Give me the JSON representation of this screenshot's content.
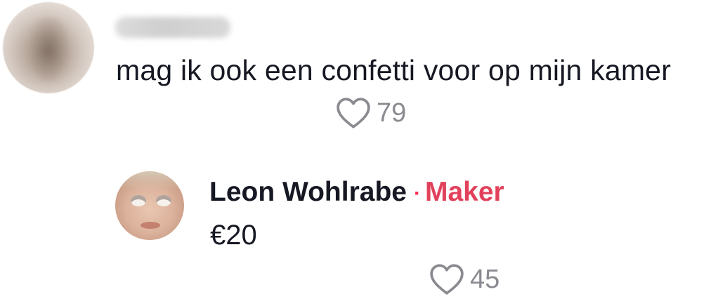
{
  "comment": {
    "username": "",
    "text": "mag ik ook een confetti voor op mijn kamer",
    "likes": "79"
  },
  "reply": {
    "author_name": "Leon Wohlrabe",
    "separator": "·",
    "author_role": "Maker",
    "text": "€20",
    "likes": "45"
  },
  "colors": {
    "text_primary": "#161823",
    "text_secondary": "#8a8b91",
    "creator_badge": "#e2415b"
  },
  "icons": {
    "like": "heart-outline-icon"
  }
}
